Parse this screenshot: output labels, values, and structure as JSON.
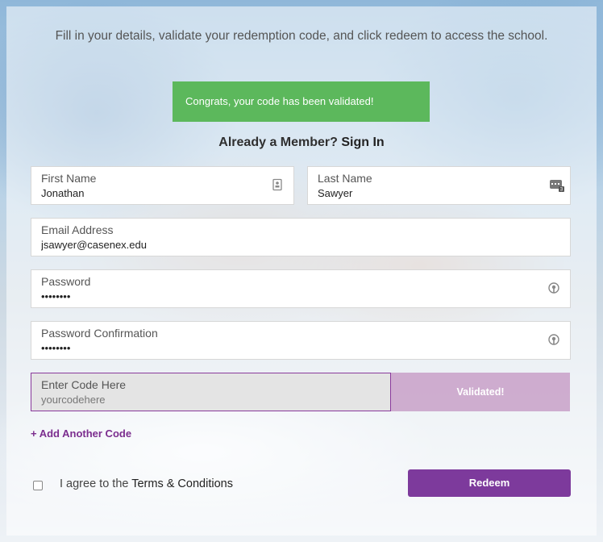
{
  "intro": "Fill in your details, validate your redemption code, and click redeem to access the school.",
  "alert": {
    "message": "Congrats, your code has been validated!",
    "color": "#5cb85c"
  },
  "member_prompt": {
    "text": "Already a Member?",
    "link": "Sign In"
  },
  "fields": {
    "first_name": {
      "label": "First Name",
      "value": "Jonathan",
      "icon": "contact-card-icon"
    },
    "last_name": {
      "label": "Last Name",
      "value": "Sawyer",
      "icon": "id-badge-icon"
    },
    "email": {
      "label": "Email Address",
      "value": "jsawyer@casenex.edu"
    },
    "password": {
      "label": "Password",
      "value": "••••••••",
      "icon": "key-icon"
    },
    "password_confirm": {
      "label": "Password Confirmation",
      "value": "••••••••",
      "icon": "key-icon"
    }
  },
  "code": {
    "label": "Enter Code Here",
    "placeholder": "yourcodehere",
    "button": "Validated!"
  },
  "add_code": "+ Add Another Code",
  "agree": {
    "prefix": "I agree to the",
    "link": "Terms & Conditions"
  },
  "redeem": {
    "label": "Redeem",
    "color": "#7d3a9c"
  }
}
